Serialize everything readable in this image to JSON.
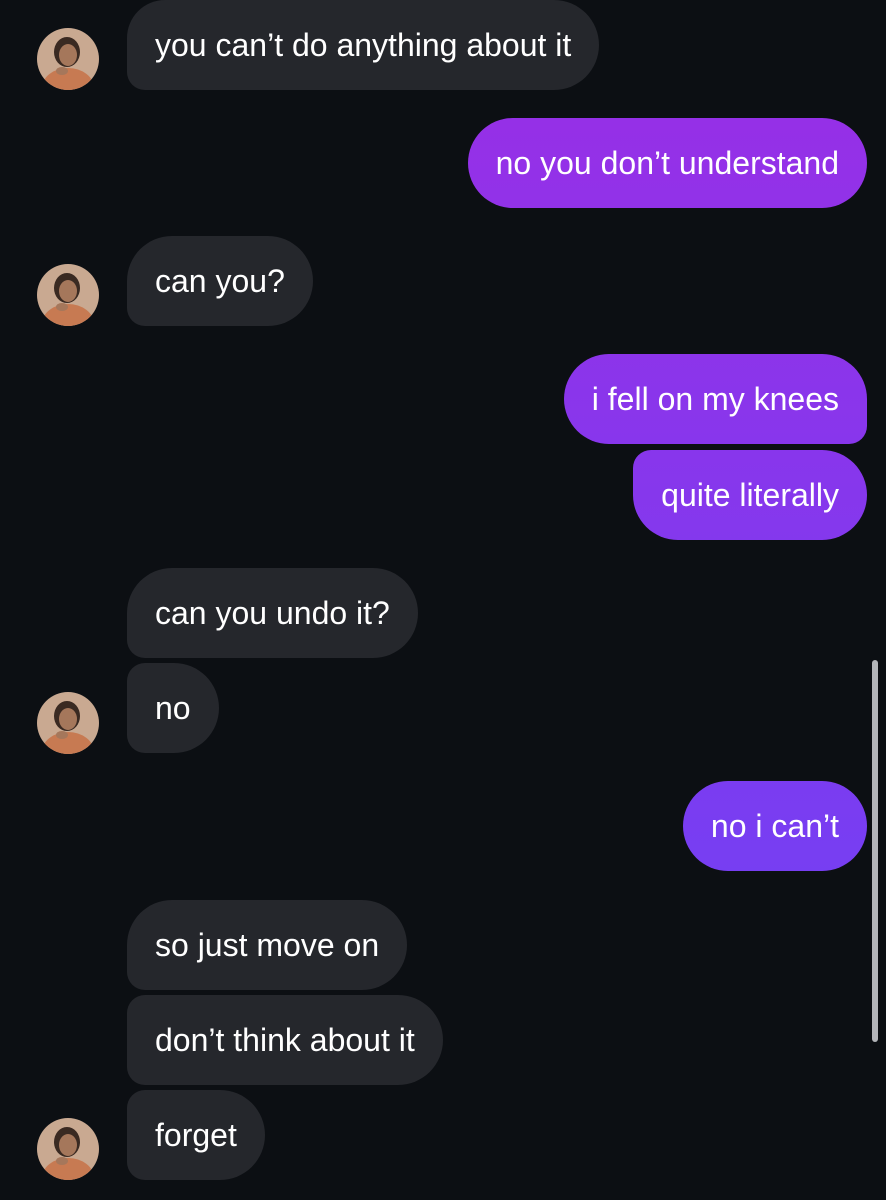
{
  "messages": [
    {
      "id": "m1",
      "side": "in",
      "text": "you can’t do anything about it"
    },
    {
      "id": "m2",
      "side": "out",
      "text": "no you don’t understand"
    },
    {
      "id": "m3",
      "side": "in",
      "text": "can you?"
    },
    {
      "id": "m4",
      "side": "out",
      "text": "i fell on my knees"
    },
    {
      "id": "m5",
      "side": "out",
      "text": "quite literally"
    },
    {
      "id": "m6",
      "side": "in",
      "text": "can you undo it?"
    },
    {
      "id": "m7",
      "side": "in",
      "text": "no"
    },
    {
      "id": "m8",
      "side": "out",
      "text": "no i can’t"
    },
    {
      "id": "m9",
      "side": "in",
      "text": "so just move on"
    },
    {
      "id": "m10",
      "side": "in",
      "text": "don’t think about it"
    },
    {
      "id": "m11",
      "side": "in",
      "text": "forget"
    }
  ],
  "avatar_icon": "profile-photo-icon",
  "colors": {
    "background": "#0c0f13",
    "incoming_bubble": "#25272c",
    "outgoing_gradient_top": "#9a2ee5",
    "outgoing_gradient_bottom": "#6a44f7",
    "text": "#ffffff",
    "scrollbar": "#b3b5b9"
  }
}
